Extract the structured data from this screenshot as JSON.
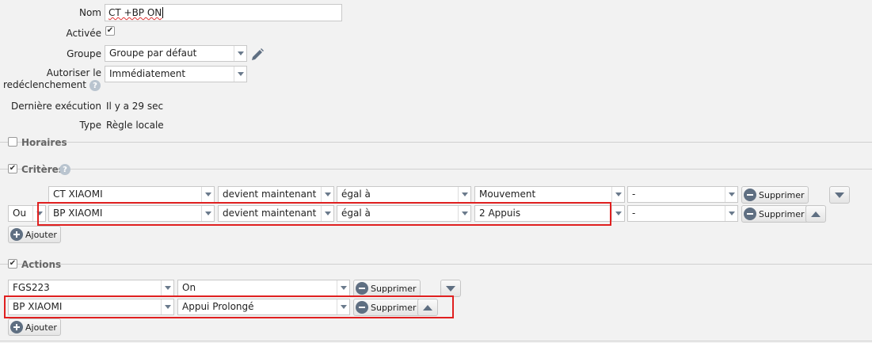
{
  "form": {
    "nom_label": "Nom",
    "nom_value": "CT +BP ON",
    "activee_label": "Activée",
    "groupe_label": "Groupe",
    "groupe_value": "Groupe par défaut",
    "autoriser_label_line1": "Autoriser le",
    "autoriser_label_line2": "redéclenchement",
    "autoriser_value": "Immédiatement",
    "derniere_label": "Dernière exécution",
    "derniere_value": "Il y a 29 sec",
    "type_label": "Type",
    "type_value": "Règle locale"
  },
  "sections": {
    "horaires": "Horaires",
    "criteres": "Critères",
    "actions": "Actions"
  },
  "criteria": [
    {
      "connector": "",
      "device": "CT XIAOMI",
      "event": "devient maintenant",
      "operator": "égal à",
      "value": "Mouvement",
      "extra": "-",
      "delete": "Supprimer"
    },
    {
      "connector": "Ou",
      "device": "BP XIAOMI",
      "event": "devient maintenant",
      "operator": "égal à",
      "value": "2 Appuis",
      "extra": "-",
      "delete": "Supprimer"
    }
  ],
  "actions": [
    {
      "device": "FGS223",
      "command": "On",
      "delete": "Supprimer"
    },
    {
      "device": "BP XIAOMI",
      "command": "Appui Prolongé",
      "delete": "Supprimer"
    }
  ],
  "buttons": {
    "add_label": "Ajouter"
  },
  "icons": {
    "help": "?",
    "edit": "pencil-icon"
  },
  "colors": {
    "highlight": "#e02020",
    "icon": "#5f6f82"
  }
}
